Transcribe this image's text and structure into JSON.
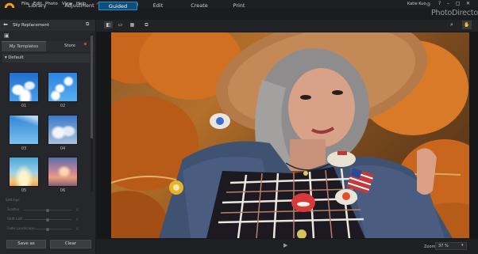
{
  "menu": [
    "File",
    "Edit",
    "Photo",
    "View",
    "Help"
  ],
  "notification_count": "1",
  "user": {
    "name": "Katie Kuo"
  },
  "modes": [
    "Library",
    "Adjustment",
    "Guided",
    "Edit",
    "Create",
    "Print"
  ],
  "active_mode": "Guided",
  "brand": "PhotoDirector",
  "panel": {
    "title": "Sky Replacement",
    "tabs": [
      "My Templates",
      "Store"
    ],
    "section": "Default",
    "thumbnails": [
      "01",
      "02",
      "03",
      "04",
      "05",
      "06"
    ],
    "settings_title": "Settings",
    "settings": [
      {
        "label": "Scatter",
        "value": "0"
      },
      {
        "label": "Shift Left",
        "value": "0"
      },
      {
        "label": "Fade Landscape",
        "value": "0"
      }
    ]
  },
  "buttons": {
    "save_as": "Save as",
    "clear": "Clear"
  },
  "zoom": {
    "label": "Zoom:",
    "value": "37 %"
  },
  "icons": {
    "back": "back-arrow-icon",
    "zoom": "magnifier-icon",
    "hand": "hand-icon",
    "play": "play-icon"
  },
  "colors": {
    "accent": "#0d4f7a",
    "accent_border": "#2a8ad0",
    "logo": "#f0a020"
  }
}
